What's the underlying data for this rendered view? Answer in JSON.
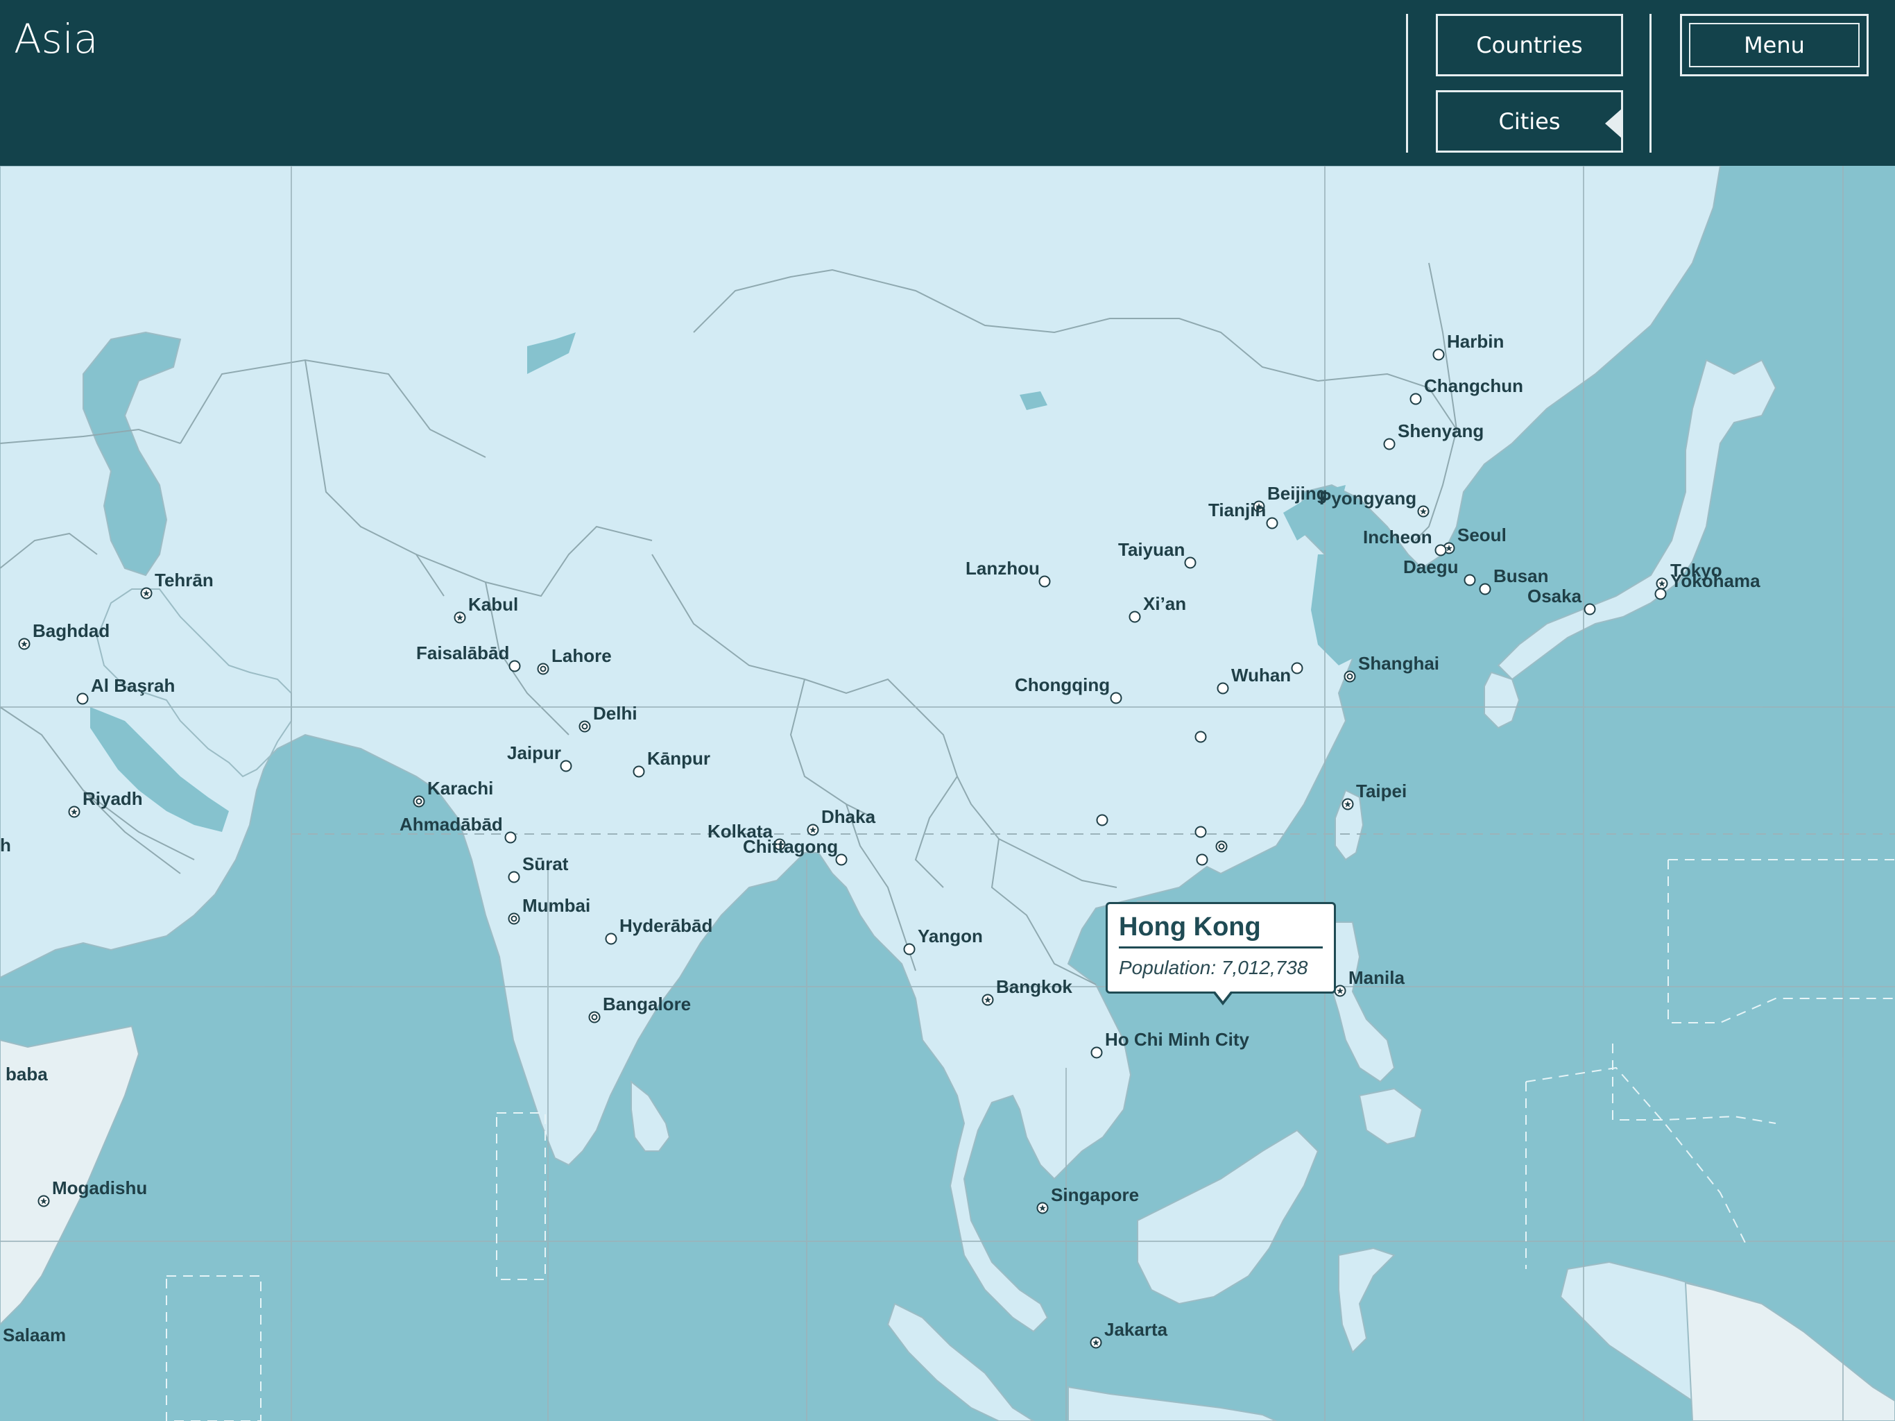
{
  "header": {
    "title": "Asia",
    "countries_label": "Countries",
    "cities_label": "Cities",
    "menu_label": "Menu"
  },
  "colors": {
    "header_bg": "#13424b",
    "ocean": "#86c2ce",
    "land": "#d3ebf4",
    "land_other": "#e6f0f3",
    "border": "#7d9aa3",
    "label": "#1f3f47"
  },
  "tooltip": {
    "name": "Hong Kong",
    "population": "Population: 7,012,738"
  },
  "cities": [
    {
      "name": "Tehrān",
      "marker": "capital"
    },
    {
      "name": "Baghdad",
      "marker": "capital"
    },
    {
      "name": "Al Başrah",
      "marker": "city"
    },
    {
      "name": "Riyadh",
      "marker": "capital"
    },
    {
      "name": "Kabul",
      "marker": "capital"
    },
    {
      "name": "Faisalābād",
      "marker": "city"
    },
    {
      "name": "Lahore",
      "marker": "major"
    },
    {
      "name": "Delhi",
      "marker": "major"
    },
    {
      "name": "Jaipur",
      "marker": "city"
    },
    {
      "name": "Kānpur",
      "marker": "city"
    },
    {
      "name": "Karachi",
      "marker": "major"
    },
    {
      "name": "Ahmadābād",
      "marker": "city"
    },
    {
      "name": "Sūrat",
      "marker": "city"
    },
    {
      "name": "Mumbai",
      "marker": "major"
    },
    {
      "name": "Hyderābād",
      "marker": "city"
    },
    {
      "name": "Bangalore",
      "marker": "major"
    },
    {
      "name": "Kolkata",
      "marker": "city"
    },
    {
      "name": "Dhaka",
      "marker": "capital"
    },
    {
      "name": "Chittagong",
      "marker": "city"
    },
    {
      "name": "Yangon",
      "marker": "city"
    },
    {
      "name": "Bangkok",
      "marker": "capital"
    },
    {
      "name": "Ho Chi Minh City",
      "marker": "city"
    },
    {
      "name": "Singapore",
      "marker": "capital"
    },
    {
      "name": "Jakarta",
      "marker": "capital"
    },
    {
      "name": "Manila",
      "marker": "capital"
    },
    {
      "name": "Taipei",
      "marker": "capital"
    },
    {
      "name": "Lanzhou",
      "marker": "city"
    },
    {
      "name": "Chongqing",
      "marker": "city"
    },
    {
      "name": "Xi’an",
      "marker": "city"
    },
    {
      "name": "Taiyuan",
      "marker": "city"
    },
    {
      "name": "Wuhan",
      "marker": "city"
    },
    {
      "name": "Shanghai",
      "marker": "major"
    },
    {
      "name": "Beijing",
      "marker": "capital"
    },
    {
      "name": "Tianjin",
      "marker": "city"
    },
    {
      "name": "Harbin",
      "marker": "city"
    },
    {
      "name": "Changchun",
      "marker": "city"
    },
    {
      "name": "Shenyang",
      "marker": "city"
    },
    {
      "name": "Pyongyang",
      "marker": "capital"
    },
    {
      "name": "Seoul",
      "marker": "capital"
    },
    {
      "name": "Incheon",
      "marker": "city"
    },
    {
      "name": "Daegu",
      "marker": "city"
    },
    {
      "name": "Busan",
      "marker": "city"
    },
    {
      "name": "Osaka",
      "marker": "city"
    },
    {
      "name": "Tokyo",
      "marker": "capital"
    },
    {
      "name": "Yokohama",
      "marker": "city"
    },
    {
      "name": "Mogadishu",
      "marker": "capital"
    },
    {
      "name": "baba",
      "marker": "none"
    },
    {
      "name": "Salaam",
      "marker": "none"
    },
    {
      "name": "h",
      "marker": "none"
    }
  ]
}
